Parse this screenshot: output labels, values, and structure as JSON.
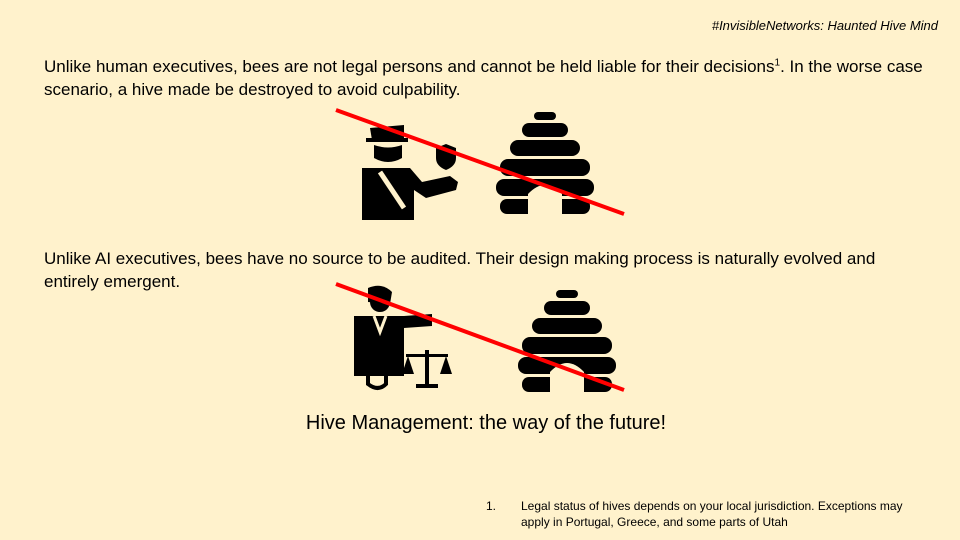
{
  "header": {
    "hashtag": "#InvisibleNetworks: Haunted Hive Mind"
  },
  "section1": {
    "text": "Unlike human executives, bees are not legal persons and cannot be held liable for their decisions",
    "superscript": "1",
    "text_after": ". In the worse case scenario, a hive made be destroyed to avoid culpability."
  },
  "section2": {
    "text": "Unlike AI executives, bees have no source to be audited. Their design making process is naturally evolved and entirely emergent."
  },
  "tagline": "Hive Management: the way of the future!",
  "footnote": {
    "number": "1.",
    "text": "Legal status of hives depends on your local jurisdiction. Exceptions may apply in Portugal, Greece, and some parts of Utah"
  },
  "colors": {
    "background": "#fff2cc",
    "strike_line": "#ff0000",
    "icon_fill": "#000000"
  },
  "icons": [
    "police-officer-icon",
    "beehive-icon",
    "judge-with-scales-icon",
    "beehive-icon"
  ]
}
